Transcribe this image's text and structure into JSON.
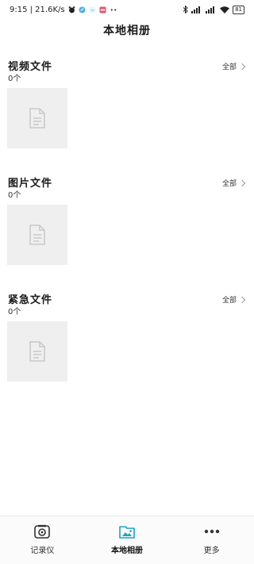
{
  "status_bar": {
    "time_speed": "9:15 | 21.6K/s",
    "battery": "81"
  },
  "header": {
    "title": "本地相册"
  },
  "sections": [
    {
      "title": "视频文件",
      "count": "0个",
      "view_all": "全部"
    },
    {
      "title": "图片文件",
      "count": "0个",
      "view_all": "全部"
    },
    {
      "title": "紧急文件",
      "count": "0个",
      "view_all": "全部"
    }
  ],
  "bottom_nav": [
    {
      "label": "记录仪",
      "icon": "camera-icon",
      "active": false
    },
    {
      "label": "本地相册",
      "icon": "folder-image-icon",
      "active": true
    },
    {
      "label": "更多",
      "icon": "more-dots-icon",
      "active": false
    }
  ],
  "colors": {
    "accent": "#1aa3c8",
    "thumb_bg": "#efefef"
  }
}
